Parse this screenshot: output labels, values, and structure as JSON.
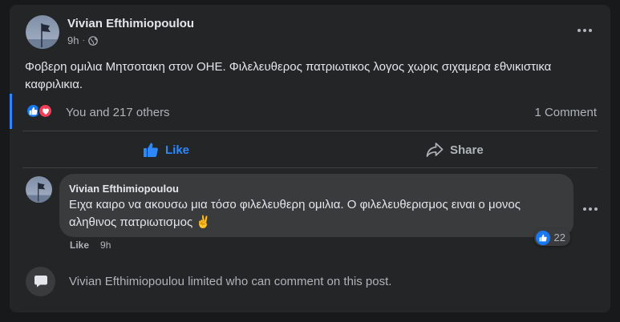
{
  "post": {
    "author": "Vivian Efthimiopoulou",
    "time": "9h",
    "separator": "·",
    "audience_icon": "globe-icon",
    "text": "Φοβερη ομιλια Μητσοτακη στον ΟΗΕ. Φιλελευθερος πατριωτικος λογος χωρις σιχαμερα εθνικιστικα καφριλικια.",
    "reaction_summary": "You and 217 others",
    "reaction_icons": [
      "like-icon",
      "love-icon"
    ],
    "comment_count": "1 Comment"
  },
  "actions": {
    "like_label": "Like",
    "share_label": "Share"
  },
  "comment": {
    "author": "Vivian Efthimiopoulou",
    "text": "Ειχα καιρο να ακουσω μια τόσο φιλελευθερη ομιλια. Ο φιλελευθερισμος ειναι ο μονος αληθινος πατριωτισμος ✌️",
    "reaction_count": "22",
    "like_label": "Like",
    "time": "9h"
  },
  "restriction_notice": "Vivian Efthimiopoulou limited who can comment on this post.",
  "colors": {
    "card_bg": "#242526",
    "page_bg": "#18191a",
    "accent_blue": "#2d88ff",
    "love_red": "#f33e58",
    "bubble_bg": "#3a3b3c"
  }
}
